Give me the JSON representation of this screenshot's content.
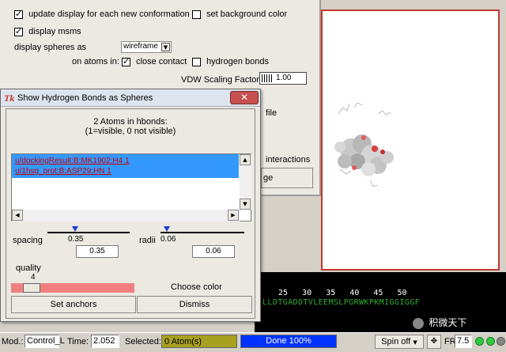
{
  "back_panel": {
    "update_display_label": "update display for each new conformation",
    "set_background_label": "set background color",
    "display_msms_label": "display msms",
    "display_spheres_label": "display spheres as",
    "display_spheres_value": "wireframe",
    "on_atoms_in_label": "on atoms in:",
    "close_contact_label": "close contact",
    "hydrogen_bonds_label": "hydrogen bonds",
    "vdw_label": "VDW Scaling Factor",
    "vdw_value": "1.00",
    "partial_file_label": "file",
    "partial_interactions_label": "interactions",
    "partial_ge_label": "ge"
  },
  "dialog": {
    "title": "Show Hydrogen Bonds as Spheres",
    "tk_logo": "Tk",
    "header_line1": "2 Atoms in hbonds:",
    "header_line2": "(1=visible, 0 not visible)",
    "atoms": [
      "u/dockingResult:B:MK1902:H4 1",
      "u/1hsg_prot:B:ASP29:HN 1"
    ],
    "spacing_label": "spacing",
    "spacing_slider_value": "0.35",
    "spacing_entry": "0.35",
    "radii_label": "radii",
    "radii_slider_value": "0.06",
    "radii_entry": "0.06",
    "quality_label": "quality",
    "quality_value": "4",
    "choose_color_label": "Choose color",
    "set_anchors_label": "Set anchors",
    "dismiss_label": "Dismiss"
  },
  "sequence": {
    "numbers": "25   30   35   40   45   50",
    "residues": "LLDTGADDTVLEEMSLPGRWKPKMIGGIGGF"
  },
  "status_bar": {
    "mod_label": "Mod.:",
    "mod_value": "Control_L",
    "time_label": "Time:",
    "time_value": "2.052",
    "selected_label": "Selected:",
    "selected_value": "0 Atom(s)",
    "progress_text": "Done 100%",
    "progress_fraction": 1.0,
    "spin_label": "Spin off",
    "fr_label": "FR:",
    "fr_value": "7.5"
  },
  "watermark": "积微天下",
  "colors": {
    "list_selection": "#3399ff",
    "progress": "#0033ff",
    "selected_field": "#a8a020",
    "quality_bar": "#f08080",
    "viewer_border": "#c0392b"
  }
}
